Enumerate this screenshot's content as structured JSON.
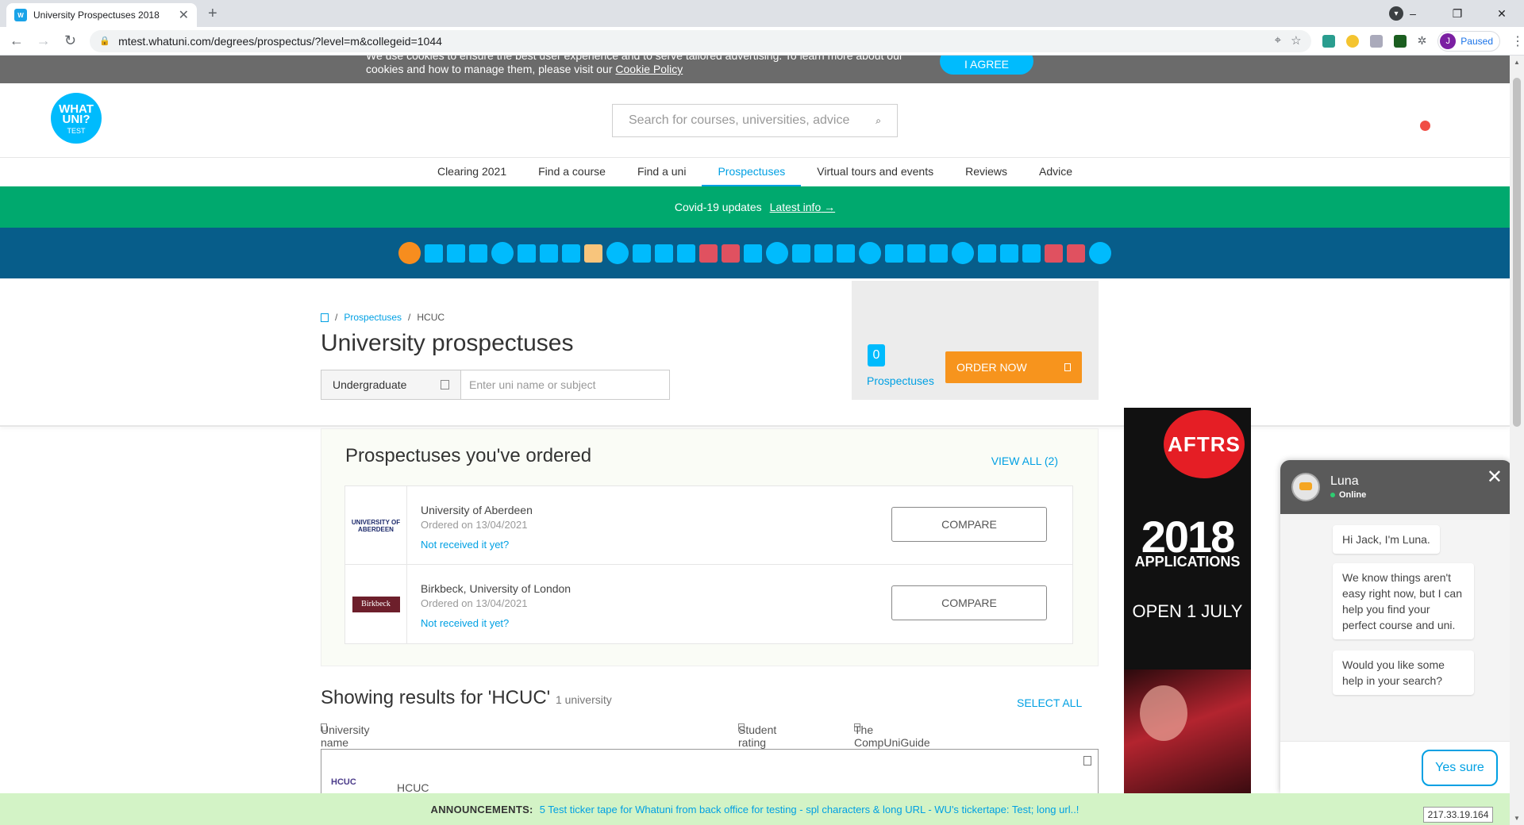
{
  "browser": {
    "tab_title": "University Prospectuses 2018",
    "tab_favicon_text": "W",
    "url": "mtest.whatuni.com/degrees/prospectus/?level=m&collegeid=1044",
    "profile_initial": "J",
    "profile_status": "Paused"
  },
  "cookie": {
    "line1": "We use cookies to ensure the best user experience and to serve tailored advertising. To learn more about our",
    "line2": "cookies and how to manage them, please visit our",
    "policy_link": "Cookie Policy",
    "agree_label": "I AGREE"
  },
  "header": {
    "logo_line1": "WHAT",
    "logo_line2": "UNI?",
    "logo_line3": "TEST",
    "search_placeholder": "Search for courses, universities, advice"
  },
  "nav": {
    "items": [
      {
        "label": "Clearing 2021"
      },
      {
        "label": "Find a course"
      },
      {
        "label": "Find a uni"
      },
      {
        "label": "Prospectuses",
        "active": true
      },
      {
        "label": "Virtual tours and events"
      },
      {
        "label": "Reviews"
      },
      {
        "label": "Advice"
      }
    ]
  },
  "covid": {
    "text": "Covid-19 updates",
    "link": "Latest info"
  },
  "page": {
    "breadcrumb_link": "Prospectuses",
    "breadcrumb_current": "HCUC",
    "title": "University prospectuses",
    "study_level": "Undergraduate",
    "search_placeholder": "Enter uni name or subject"
  },
  "order_box": {
    "count": "0",
    "count_label": "Prospectuses",
    "order_button": "ORDER NOW"
  },
  "ordered": {
    "heading": "Prospectuses you've ordered",
    "view_all": "VIEW ALL (2)",
    "items": [
      {
        "logo_text": "UNIVERSITY OF ABERDEEN",
        "name": "University of Aberdeen",
        "date": "Ordered on 13/04/2021",
        "not_received": "Not received it yet?",
        "compare": "COMPARE"
      },
      {
        "logo_text": "Birkbeck",
        "name": "Birkbeck, University of London",
        "date": "Ordered on 13/04/2021",
        "not_received": "Not received it yet?",
        "compare": "COMPARE"
      }
    ]
  },
  "results": {
    "title": "Showing results for 'HCUC'",
    "count": "1 university",
    "select_all": "SELECT ALL",
    "col_name": "University name",
    "col_rating": "Student rating",
    "col_ranking": "The CompUniGuide ranking",
    "first_logo": "HCUC",
    "first_name": "HCUC"
  },
  "ad": {
    "brand": "AFTRS",
    "year": "2018",
    "applications": "APPLICATIONS",
    "open": "OPEN 1 JULY"
  },
  "chat": {
    "name": "Luna",
    "status": "Online",
    "messages": [
      "Hi Jack, I'm Luna.",
      "We know things aren't easy right now, but I can help you find your perfect course and uni.",
      "Would you like some help in your search?"
    ],
    "reply": "Yes sure"
  },
  "announcement": {
    "label": "ANNOUNCEMENTS:",
    "text": "5 Test ticker tape for Whatuni from back office for testing - spl characters & long URL - WU's tickertape: Test; long url..!"
  },
  "ip": "217.33.19.164",
  "colors": {
    "accent": "#00a0e3",
    "covid_green": "#00a96e",
    "shapes_bg": "#075d8a",
    "order_orange": "#f7941d"
  }
}
